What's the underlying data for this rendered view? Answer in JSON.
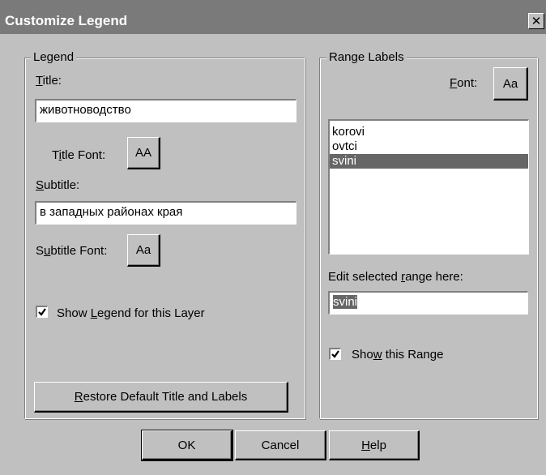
{
  "window": {
    "title": "Customize Legend",
    "close_glyph": "✕"
  },
  "legend_group": {
    "label": "Legend",
    "title_label_hotkey": "T",
    "title_label_rest": "itle:",
    "title_value": "животноводство",
    "title_font_label_pre": "T",
    "title_font_label_hotkey": "i",
    "title_font_label_rest": "tle Font:",
    "title_font_button": "AA",
    "subtitle_label_hotkey": "S",
    "subtitle_label_rest": "ubtitle:",
    "subtitle_value": "в западных районах края",
    "subtitle_font_label_pre": "S",
    "subtitle_font_label_hotkey": "u",
    "subtitle_font_label_rest": "btitle Font:",
    "subtitle_font_button": "Aa",
    "show_legend_pre": "Show ",
    "show_legend_hotkey": "L",
    "show_legend_rest": "egend for this Layer",
    "show_legend_checked": true,
    "restore_button_hotkey": "R",
    "restore_button_rest": "estore Default Title and Labels"
  },
  "range_group": {
    "label": "Range Labels",
    "font_label_hotkey": "F",
    "font_label_rest": "ont:",
    "font_button": "Aa",
    "ranges": [
      "korovi",
      "ovtci",
      "svini"
    ],
    "selected_index": 2,
    "edit_label_pre": "Edit selected ",
    "edit_label_hotkey": "r",
    "edit_label_rest": "ange here:",
    "edit_value": "svini",
    "show_range_pre": "Sho",
    "show_range_hotkey": "w",
    "show_range_rest": " this Range",
    "show_range_checked": true
  },
  "buttons": {
    "ok": "OK",
    "cancel": "Cancel",
    "help_hotkey": "H",
    "help_rest": "elp"
  }
}
